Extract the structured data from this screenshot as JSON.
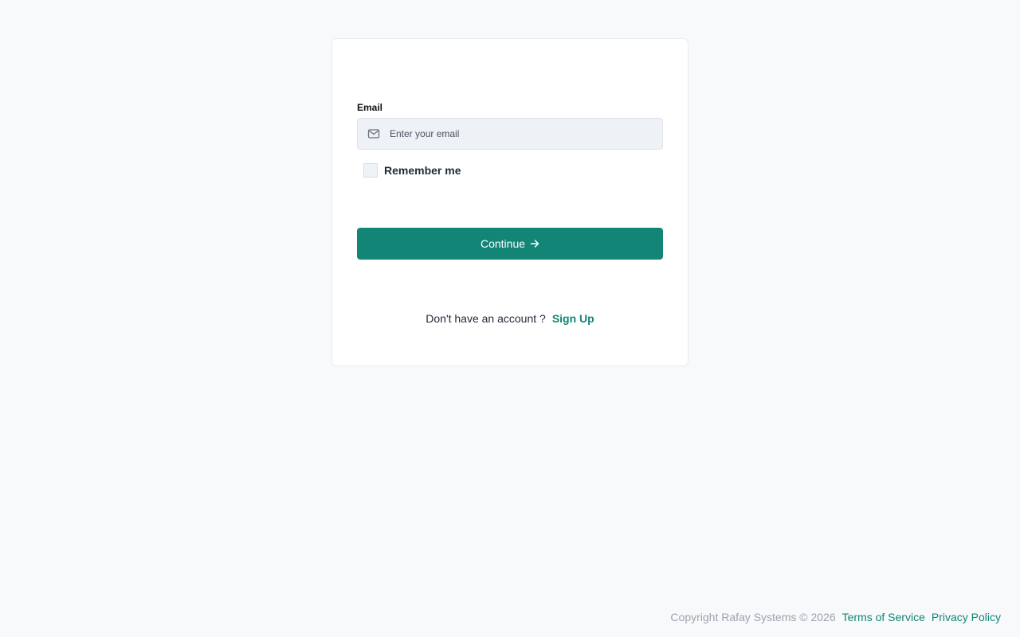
{
  "login": {
    "email_label": "Email",
    "email_placeholder": "Enter your email",
    "email_value": "",
    "email_icon": "mail-icon",
    "remember_label": "Remember me",
    "remember_checked": false,
    "continue_label": "Continue",
    "continue_icon": "arrow-right-icon",
    "signup_prompt": "Don't have an account ?",
    "signup_link": "Sign Up"
  },
  "footer": {
    "copyright": "Copyright Rafay Systems © 2026",
    "terms": "Terms of Service",
    "privacy": "Privacy Policy"
  },
  "colors": {
    "brand": "#128577",
    "background": "#f7f9fb",
    "card": "#ffffff",
    "input_bg": "#eef1f5",
    "muted_text": "#9ca3af"
  }
}
